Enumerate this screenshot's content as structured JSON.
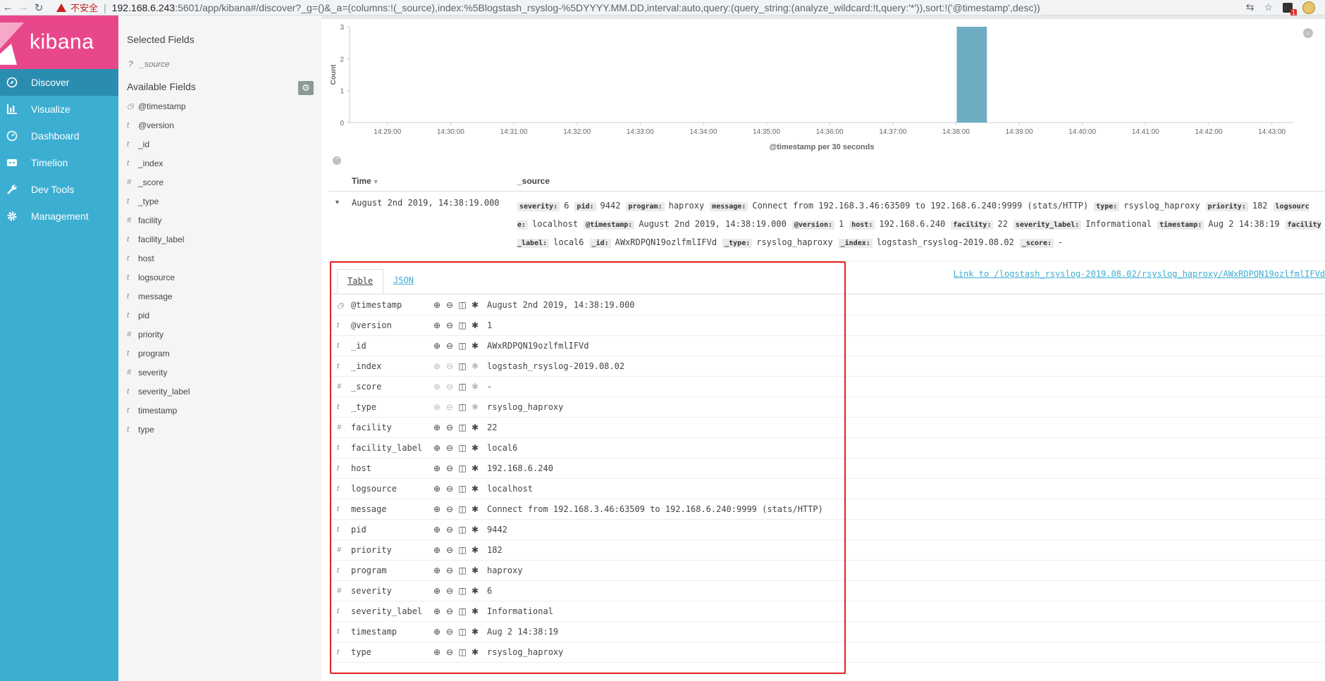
{
  "browser": {
    "insecure_label": "不安全",
    "url_host": "192.168.6.243",
    "url_rest": ":5601/app/kibana#/discover?_g=()&_a=(columns:!(_source),index:%5Blogstash_rsyslog-%5DYYYY.MM.DD,interval:auto,query:(query_string:(analyze_wildcard:!t,query:'*')),sort:!('@timestamp',desc))",
    "ext_badge": "1"
  },
  "nav": {
    "logo": "kibana",
    "items": [
      {
        "label": "Discover",
        "icon": "compass-icon"
      },
      {
        "label": "Visualize",
        "icon": "bar-chart-icon"
      },
      {
        "label": "Dashboard",
        "icon": "dashboard-icon"
      },
      {
        "label": "Timelion",
        "icon": "timelion-icon"
      },
      {
        "label": "Dev Tools",
        "icon": "wrench-icon"
      },
      {
        "label": "Management",
        "icon": "gear-icon"
      }
    ]
  },
  "sidebar": {
    "selected_title": "Selected Fields",
    "selected_fields": [
      {
        "type": "?",
        "name": "_source"
      }
    ],
    "available_title": "Available Fields",
    "available_fields": [
      {
        "type": "clock",
        "name": "@timestamp"
      },
      {
        "type": "t",
        "name": "@version"
      },
      {
        "type": "t",
        "name": "_id"
      },
      {
        "type": "t",
        "name": "_index"
      },
      {
        "type": "#",
        "name": "_score"
      },
      {
        "type": "t",
        "name": "_type"
      },
      {
        "type": "#",
        "name": "facility"
      },
      {
        "type": "t",
        "name": "facility_label"
      },
      {
        "type": "t",
        "name": "host"
      },
      {
        "type": "t",
        "name": "logsource"
      },
      {
        "type": "t",
        "name": "message"
      },
      {
        "type": "t",
        "name": "pid"
      },
      {
        "type": "#",
        "name": "priority"
      },
      {
        "type": "t",
        "name": "program"
      },
      {
        "type": "#",
        "name": "severity"
      },
      {
        "type": "t",
        "name": "severity_label"
      },
      {
        "type": "t",
        "name": "timestamp"
      },
      {
        "type": "t",
        "name": "type"
      }
    ]
  },
  "chart_data": {
    "type": "bar",
    "xlabel": "@timestamp per 30 seconds",
    "ylabel": "Count",
    "y_ticks": [
      "3",
      "2",
      "1",
      "0"
    ],
    "ylim": [
      0,
      3
    ],
    "x_ticks": [
      "14:29:00",
      "14:30:00",
      "14:31:00",
      "14:32:00",
      "14:33:00",
      "14:34:00",
      "14:35:00",
      "14:36:00",
      "14:37:00",
      "14:38:00",
      "14:39:00",
      "14:40:00",
      "14:41:00",
      "14:42:00",
      "14:43:00"
    ],
    "x_tick_minutes": [
      0,
      1,
      2,
      3,
      4,
      5,
      6,
      7,
      8,
      9,
      10,
      11,
      12,
      13,
      14
    ],
    "bars": [
      {
        "start_minute": 9.0,
        "end_minute": 9.5,
        "value": 3
      }
    ],
    "grid": false
  },
  "table": {
    "col_time": "Time",
    "col_source": "_source",
    "row_time": "August 2nd 2019, 14:38:19.000",
    "source_pairs": [
      {
        "k": "severity:",
        "v": "6"
      },
      {
        "k": "pid:",
        "v": "9442"
      },
      {
        "k": "program:",
        "v": "haproxy"
      },
      {
        "k": "message:",
        "v": "Connect from 192.168.3.46:63509 to 192.168.6.240:9999 (stats/HTTP)"
      },
      {
        "k": "type:",
        "v": "rsyslog_haproxy"
      },
      {
        "k": "priority:",
        "v": "182"
      },
      {
        "k": "logsource:",
        "v": "localhost"
      },
      {
        "k": "@timestamp:",
        "v": "August 2nd 2019, 14:38:19.000"
      },
      {
        "k": "@version:",
        "v": "1"
      },
      {
        "k": "host:",
        "v": "192.168.6.240"
      },
      {
        "k": "facility:",
        "v": "22"
      },
      {
        "k": "severity_label:",
        "v": "Informational"
      },
      {
        "k": "timestamp:",
        "v": "Aug 2 14:38:19"
      },
      {
        "k": "facility_label:",
        "v": "local6"
      },
      {
        "k": "_id:",
        "v": "AWxRDPQN19ozlfmlIFVd"
      },
      {
        "k": "_type:",
        "v": "rsyslog_haproxy"
      },
      {
        "k": "_index:",
        "v": "logstash_rsyslog-2019.08.02"
      },
      {
        "k": "_score:",
        "v": "-"
      }
    ]
  },
  "detail": {
    "tab_table": "Table",
    "tab_json": "JSON",
    "link": "Link to /logstash_rsyslog-2019.08.02/rsyslog_haproxy/AWxRDPQN19ozlfmlIFVd",
    "rows": [
      {
        "type": "clock",
        "name": "@timestamp",
        "value": "August 2nd 2019, 14:38:19.000",
        "disabled": false
      },
      {
        "type": "t",
        "name": "@version",
        "value": "1",
        "disabled": false
      },
      {
        "type": "t",
        "name": "_id",
        "value": "AWxRDPQN19ozlfmlIFVd",
        "disabled": false
      },
      {
        "type": "t",
        "name": "_index",
        "value": "logstash_rsyslog-2019.08.02",
        "disabled": true
      },
      {
        "type": "#",
        "name": "_score",
        "value": " -",
        "disabled": true
      },
      {
        "type": "t",
        "name": "_type",
        "value": "rsyslog_haproxy",
        "disabled": true
      },
      {
        "type": "#",
        "name": "facility",
        "value": "22",
        "disabled": false
      },
      {
        "type": "t",
        "name": "facility_label",
        "value": "local6",
        "disabled": false
      },
      {
        "type": "t",
        "name": "host",
        "value": "192.168.6.240",
        "disabled": false
      },
      {
        "type": "t",
        "name": "logsource",
        "value": "localhost",
        "disabled": false
      },
      {
        "type": "t",
        "name": "message",
        "value": "Connect from 192.168.3.46:63509 to 192.168.6.240:9999 (stats/HTTP)",
        "disabled": false
      },
      {
        "type": "t",
        "name": "pid",
        "value": "9442",
        "disabled": false
      },
      {
        "type": "#",
        "name": "priority",
        "value": "182",
        "disabled": false
      },
      {
        "type": "t",
        "name": "program",
        "value": "haproxy",
        "disabled": false
      },
      {
        "type": "#",
        "name": "severity",
        "value": "6",
        "disabled": false
      },
      {
        "type": "t",
        "name": "severity_label",
        "value": "Informational",
        "disabled": false
      },
      {
        "type": "t",
        "name": "timestamp",
        "value": "Aug  2 14:38:19",
        "disabled": false
      },
      {
        "type": "t",
        "name": "type",
        "value": "rsyslog_haproxy",
        "disabled": false
      }
    ]
  },
  "colors": {
    "nav_bg": "#3caed2",
    "logo_bg": "#e8488b",
    "bar": "#6eadc1",
    "highlight": "#e02020"
  }
}
